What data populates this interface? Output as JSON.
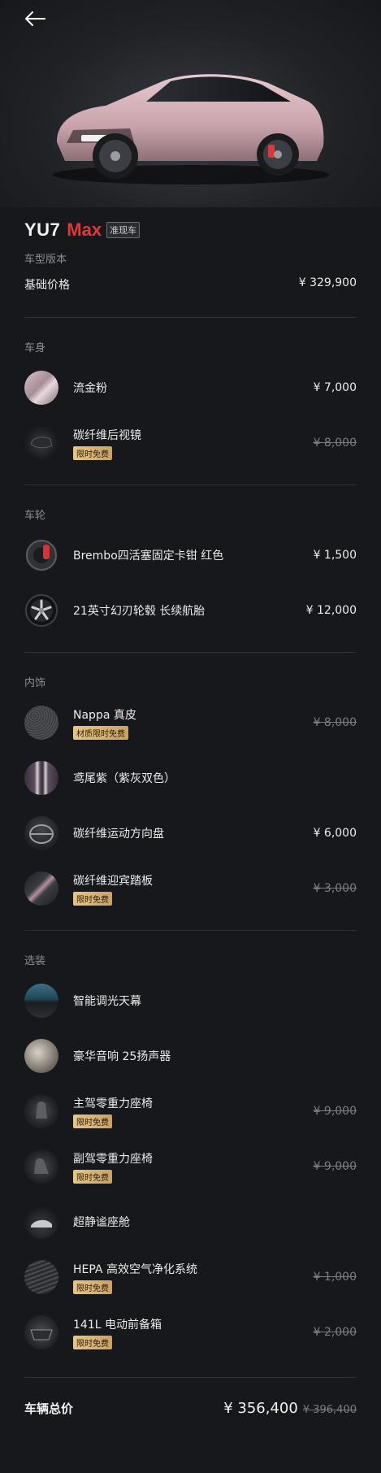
{
  "header": {
    "back_icon": "arrow-left-icon"
  },
  "vehicle": {
    "model": "YU7",
    "variant": "Max",
    "tag": "准现车"
  },
  "version_label": "车型版本",
  "base": {
    "label": "基础价格",
    "price": "¥ 329,900"
  },
  "sections": {
    "body": {
      "title": "车身",
      "items": [
        {
          "name": "流金粉",
          "price": "¥ 7,000",
          "strike": false,
          "badge": "",
          "icon": "paint-swatch-icon"
        },
        {
          "name": "碳纤维后视镜",
          "price": "¥ 8,000",
          "strike": true,
          "badge": "限时免费",
          "icon": "mirror-icon"
        }
      ]
    },
    "wheels": {
      "title": "车轮",
      "items": [
        {
          "name": "Brembo四活塞固定卡钳 红色",
          "price": "¥ 1,500",
          "strike": false,
          "badge": "",
          "icon": "brake-caliper-icon"
        },
        {
          "name": "21英寸幻刃轮毂 长续航胎",
          "price": "¥ 12,000",
          "strike": false,
          "badge": "",
          "icon": "wheel-icon"
        }
      ]
    },
    "interior": {
      "title": "内饰",
      "items": [
        {
          "name": "Nappa 真皮",
          "price": "¥ 8,000",
          "strike": true,
          "badge": "材质限时免费",
          "icon": "leather-icon"
        },
        {
          "name": "鸢尾紫（紫灰双色）",
          "price": "",
          "strike": false,
          "badge": "",
          "icon": "seat-color-icon"
        },
        {
          "name": "碳纤维运动方向盘",
          "price": "¥ 6,000",
          "strike": false,
          "badge": "",
          "icon": "steering-wheel-icon"
        },
        {
          "name": "碳纤维迎宾踏板",
          "price": "¥ 3,000",
          "strike": true,
          "badge": "限时免费",
          "icon": "sill-plate-icon"
        }
      ]
    },
    "options": {
      "title": "选装",
      "items": [
        {
          "name": "智能调光天幕",
          "price": "",
          "strike": false,
          "badge": "",
          "icon": "sunroof-icon"
        },
        {
          "name": "豪华音响 25扬声器",
          "price": "",
          "strike": false,
          "badge": "",
          "icon": "speaker-icon"
        },
        {
          "name": "主驾零重力座椅",
          "price": "¥ 9,000",
          "strike": true,
          "badge": "限时免费",
          "icon": "driver-seat-icon"
        },
        {
          "name": "副驾零重力座椅",
          "price": "¥ 9,000",
          "strike": true,
          "badge": "限时免费",
          "icon": "passenger-seat-icon"
        },
        {
          "name": "超静谧座舱",
          "price": "",
          "strike": false,
          "badge": "",
          "icon": "quiet-cabin-icon"
        },
        {
          "name": "HEPA 高效空气净化系统",
          "price": "¥ 1,000",
          "strike": true,
          "badge": "限时免费",
          "icon": "air-filter-icon"
        },
        {
          "name": "141L 电动前备箱",
          "price": "¥ 2,000",
          "strike": true,
          "badge": "限时免费",
          "icon": "frunk-icon"
        }
      ]
    }
  },
  "total": {
    "label": "车辆总价",
    "price": "¥ 356,400",
    "original": "¥ 396,400"
  }
}
